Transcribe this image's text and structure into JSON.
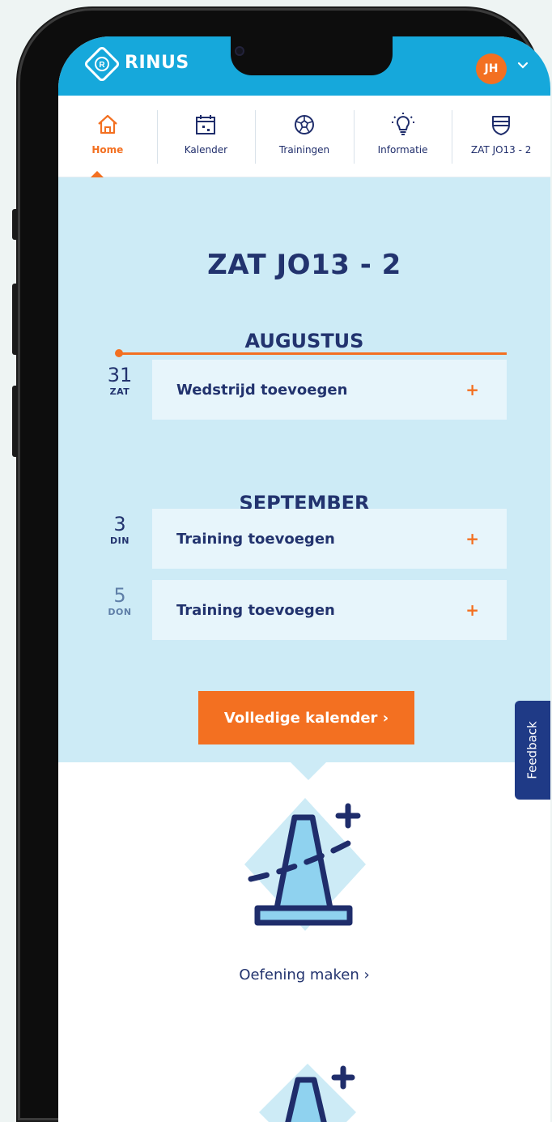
{
  "header": {
    "brand": "RINUS",
    "user_initials": "JH"
  },
  "tabs": [
    {
      "label": "Home",
      "icon": "home-icon",
      "active": true
    },
    {
      "label": "Kalender",
      "icon": "calendar-icon",
      "active": false
    },
    {
      "label": "Trainingen",
      "icon": "football-icon",
      "active": false
    },
    {
      "label": "Informatie",
      "icon": "lightbulb-icon",
      "active": false
    },
    {
      "label": "ZAT JO13 - 2",
      "icon": "shield-icon",
      "active": false
    }
  ],
  "main": {
    "team_title": "ZAT JO13 - 2",
    "months": [
      {
        "name": "AUGUSTUS",
        "items": [
          {
            "day": "31",
            "weekday": "ZAT",
            "label": "Wedstrijd toevoegen",
            "action": "+"
          }
        ]
      },
      {
        "name": "SEPTEMBER",
        "items": [
          {
            "day": "3",
            "weekday": "DIN",
            "label": "Training toevoegen",
            "action": "+"
          },
          {
            "day": "5",
            "weekday": "DON",
            "label": "Training toevoegen",
            "action": "+"
          }
        ]
      }
    ],
    "calendar_button": "Volledige kalender  ›"
  },
  "feedback_label": "Feedback",
  "exercise_link": "Oefening maken  ›",
  "colors": {
    "header_blue": "#16a8db",
    "accent_orange": "#f37021",
    "navy": "#22336e",
    "light_blue_bg": "#cdebf6"
  }
}
